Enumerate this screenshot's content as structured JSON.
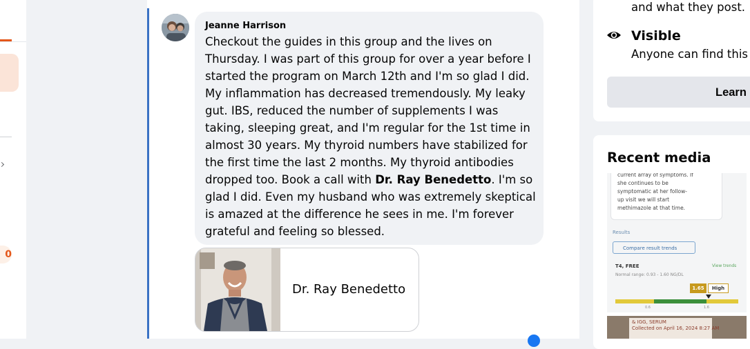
{
  "left_nav": {
    "badge": "0"
  },
  "post": {
    "author": "Jeanne Harrison",
    "comment_before": "Checkout the guides in this group and the lives on Thursday. I was part of this group for over a year before I started the program on March 12th and I'm so glad I did. My inflammation has decreased tremendously. My leaky gut. IBS, reduced the number of supplements I was taking, sleeping great, and I'm regular for the 1st time in almost 30 years. My thyroid numbers have stabilized for the first time the last 2 months. My thyroid antibodies dropped too. Book a call with ",
    "comment_mention": "Dr. Ray Benedetto",
    "comment_after": ". I'm so glad I did. Even my husband who was extremely skeptical is amazed at the difference he sees in me. I'm forever grateful and feeling so blessed.",
    "link_title": "Dr. Ray Benedetto"
  },
  "about": {
    "line1": "and what they post.",
    "visible_title": "Visible",
    "visible_desc": "Anyone can find this",
    "learn_label": "Learn"
  },
  "recent_media": {
    "title": "Recent media",
    "thumb1": {
      "note_lines": [
        "current array of symptoms. If",
        "she continues to be",
        "symptomatic at her follow-",
        "up visit we will start",
        "methimazole at that time."
      ],
      "results": "Results",
      "compare": "Compare result trends",
      "test_name": "T4, FREE",
      "normal_range": "Normal range: 0.93 - 1.60 NG/DL",
      "view_trends": "View trends",
      "value": "1.65",
      "flag": "High",
      "tick_low": "0.6",
      "tick_high": "1.6"
    },
    "thumb2": {
      "label_line1": "& IGG, SERUM",
      "label_line2": "Collected on April 16, 2024 8:27 AM"
    }
  },
  "colors": {
    "thread_line": "#3a72c4",
    "accent_orange": "#e4571a",
    "bubble_bg": "#f0f2f5",
    "button_bg": "#e4e6eb"
  }
}
